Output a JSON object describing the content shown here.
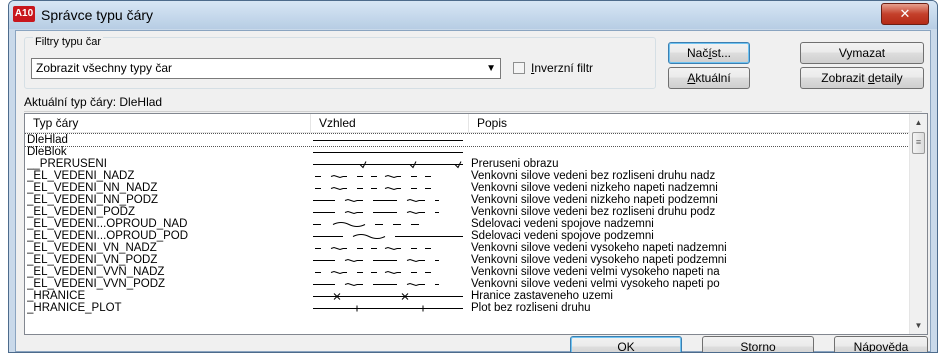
{
  "window": {
    "app_icon": "A10",
    "title": "Správce typu čáry",
    "close_label": "✕"
  },
  "filters": {
    "group_label": "Filtry typu čar",
    "selected": "Zobrazit všechny typy čar",
    "invert_label": "Inverzní filtr",
    "invert_checked": false
  },
  "buttons": {
    "load": "Načíst...",
    "delete": "Vymazat",
    "current": "Aktuální",
    "show_details": "Zobrazit detaily",
    "ok": "OK",
    "cancel": "Storno",
    "help": "Nápověda"
  },
  "current_linetype": {
    "label": "Aktuální typ čáry:",
    "value": "DleHlad"
  },
  "list": {
    "columns": [
      "Typ čáry",
      "Vzhled",
      "Popis"
    ],
    "rows": [
      {
        "name": "DleHlad",
        "pattern": "solid",
        "description": ""
      },
      {
        "name": "DleBlok",
        "pattern": "solid",
        "description": ""
      },
      {
        "name": "__PRERUSENI",
        "pattern": "break",
        "description": "Preruseni obrazu"
      },
      {
        "name": "_EL_VEDENI_NADZ",
        "pattern": "dash-sym",
        "description": "Venkovni silove vedeni bez rozliseni druhu nadz"
      },
      {
        "name": "_EL_VEDENI_NN_NADZ",
        "pattern": "dash-sym",
        "description": "Venkovni silove vedeni nizkeho napeti nadzemni"
      },
      {
        "name": "_EL_VEDENI_NN_PODZ",
        "pattern": "long-sym",
        "description": "Venkovni silove vedeni nizkeho napeti podzemni"
      },
      {
        "name": "_EL_VEDENI_PODZ",
        "pattern": "long-sym",
        "description": "Venkovni silove vedeni bez rozliseni druhu podz"
      },
      {
        "name": "_EL_VEDENI...OPROUD_NAD",
        "pattern": "wave-dash",
        "description": "Sdelovaci vedeni spojove nadzemni"
      },
      {
        "name": "_EL_VEDENI...OPROUD_POD",
        "pattern": "wave-long",
        "description": "Sdelovaci vedeni spojove podzemni"
      },
      {
        "name": "_EL_VEDENI_VN_NADZ",
        "pattern": "dash-sym",
        "description": "Venkovni silove vedeni vysokeho napeti nadzemni"
      },
      {
        "name": "_EL_VEDENI_VN_PODZ",
        "pattern": "long-sym",
        "description": "Venkovni silove vedeni vysokeho napeti podzemni"
      },
      {
        "name": "_EL_VEDENI_VVN_NADZ",
        "pattern": "dash-sym",
        "description": "Venkovni silove vedeni velmi vysokeho napeti na"
      },
      {
        "name": "_EL_VEDENI_VVN_PODZ",
        "pattern": "long-sym",
        "description": "Venkovni silove vedeni velmi vysokeho napeti po"
      },
      {
        "name": "_HRANICE",
        "pattern": "cross",
        "description": "Hranice zastaveneho uzemi"
      },
      {
        "name": "_HRANICE_PLOT",
        "pattern": "tick",
        "description": "Plot bez rozliseni druhu"
      }
    ]
  },
  "colors": {
    "frame": "#c9d9ea",
    "close_button": "#c4402b",
    "default_button_border": "#3c7fb1"
  }
}
